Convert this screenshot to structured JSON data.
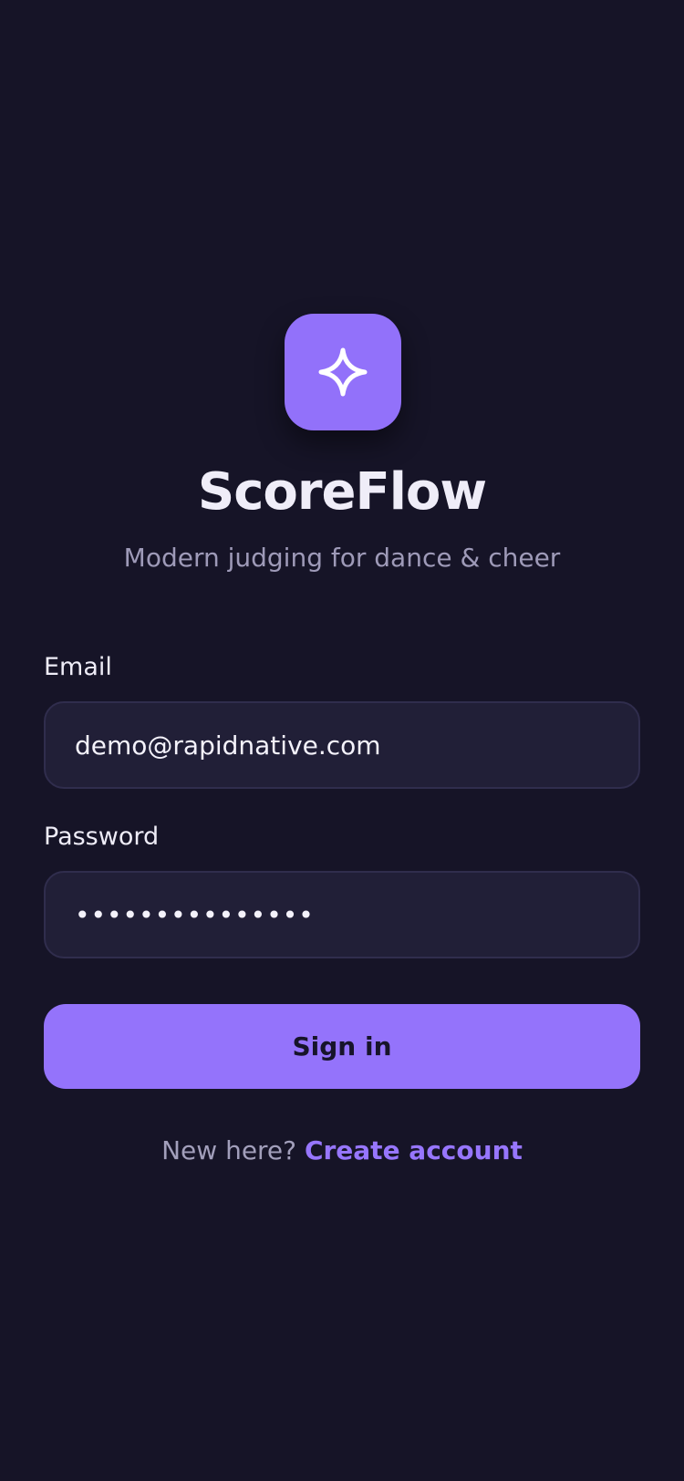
{
  "app": {
    "icon": "sparkle-icon",
    "title": "ScoreFlow",
    "subtitle": "Modern judging for dance & cheer"
  },
  "form": {
    "email_label": "Email",
    "email_value": "demo@rapidnative.com",
    "password_label": "Password",
    "password_value": "•••••••••••••••",
    "submit_label": "Sign in"
  },
  "footer": {
    "prompt": "New here?",
    "link_label": "Create account"
  },
  "colors": {
    "background": "#161427",
    "accent": "#9473fb",
    "field_background": "#211f37",
    "muted_text": "#9e9ab8"
  }
}
